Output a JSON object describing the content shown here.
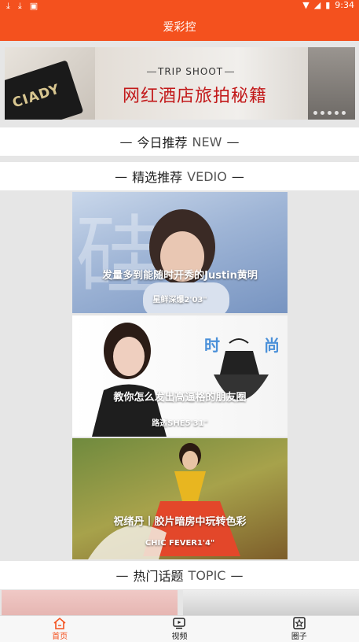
{
  "status_bar": {
    "time": "9:34"
  },
  "header": {
    "title": "爱彩控"
  },
  "banner": {
    "kicker": "TRIP SHOOT",
    "title": "网红酒店旅拍秘籍",
    "clutch_text": "CIADY",
    "dot_count": 5
  },
  "sections": {
    "today": {
      "title": "今日推荐",
      "en": "NEW"
    },
    "featured": {
      "title": "精选推荐",
      "en": "VEDIO"
    },
    "topics": {
      "title": "热门话题",
      "en": "TOPIC"
    }
  },
  "videos": [
    {
      "title": "发量多到能随时开秀的Justin黄明",
      "subtitle": "星鲜深爆2'03\""
    },
    {
      "title": "教你怎么发出高逼格的朋友圈",
      "subtitle": "路透SHE5'31\"",
      "overlay": "时    尚"
    },
    {
      "title": "祝绪丹丨胶片暗房中玩转色彩",
      "subtitle": "CHIC FEVER1'4\""
    }
  ],
  "tabbar": {
    "items": [
      {
        "label": "首页",
        "icon": "home-icon",
        "active": true
      },
      {
        "label": "视频",
        "icon": "video-icon",
        "active": false
      },
      {
        "label": "圈子",
        "icon": "star-icon",
        "active": false
      }
    ]
  },
  "colors": {
    "accent": "#f4511e",
    "banner_title": "#c2191a"
  }
}
